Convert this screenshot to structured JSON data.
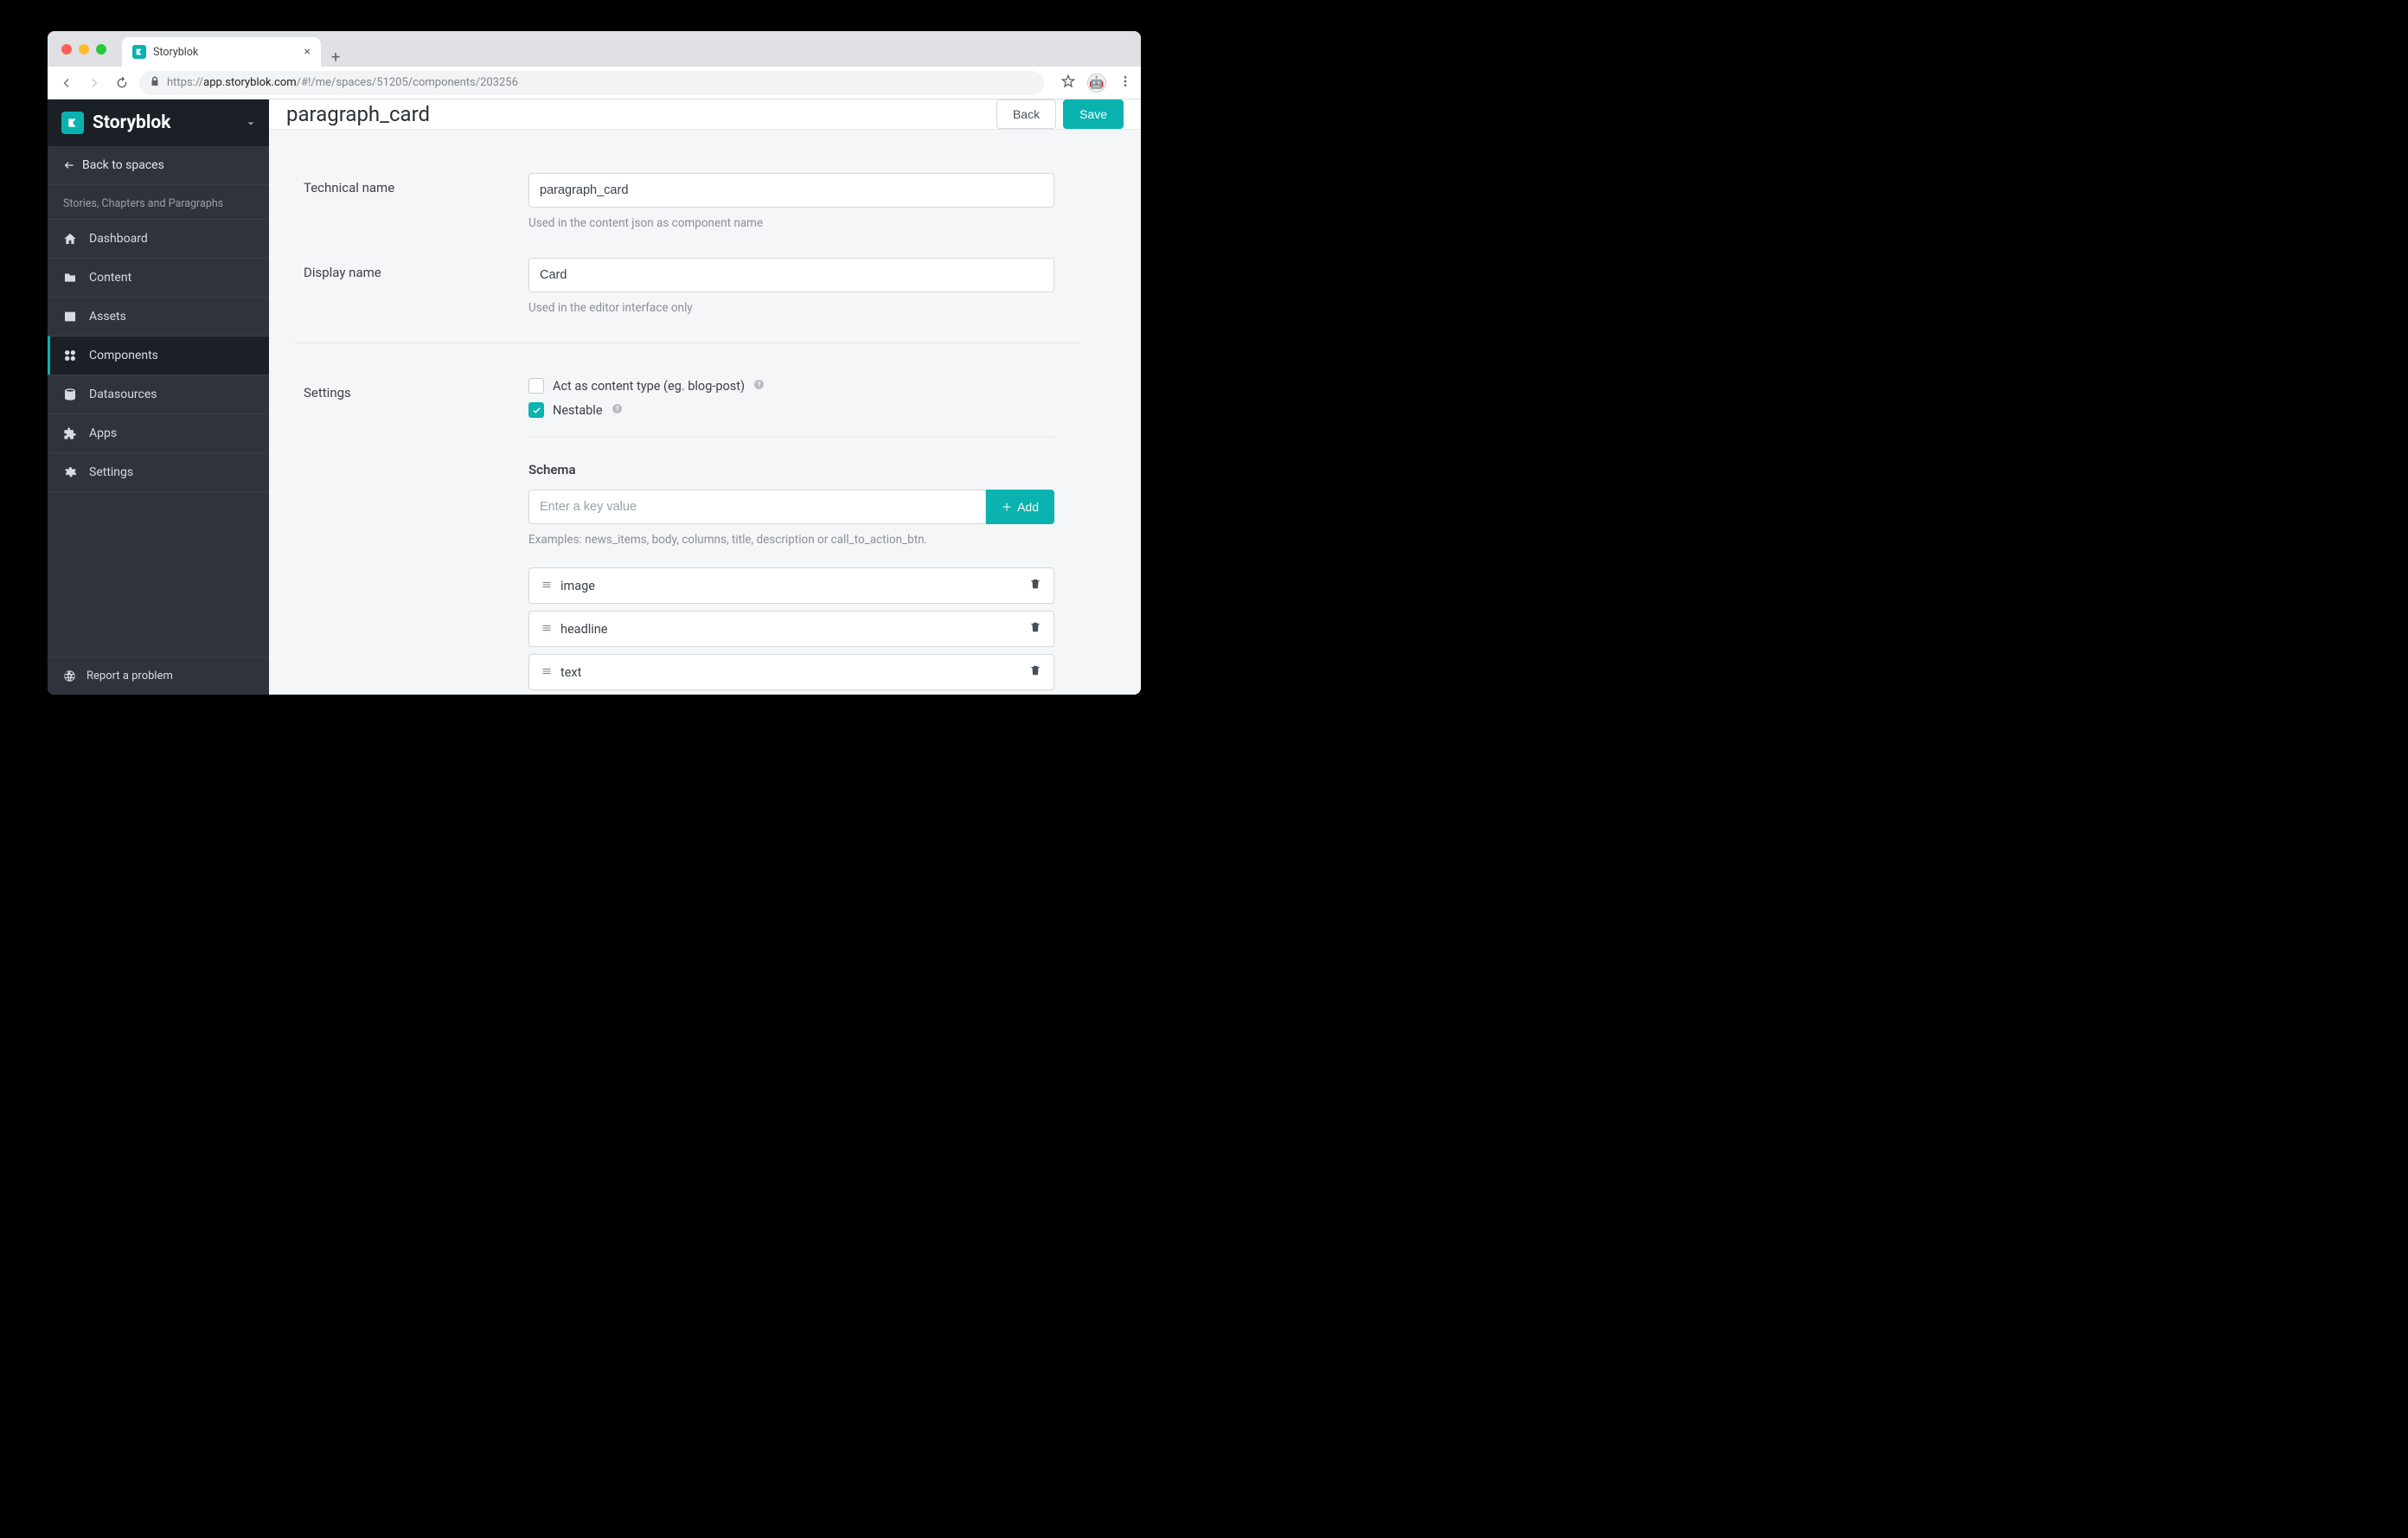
{
  "browser": {
    "tab_title": "Storyblok",
    "url_prefix": "https://",
    "url_host": "app.storyblok.com",
    "url_path": "/#!/me/spaces/51205/components/203256"
  },
  "sidebar": {
    "brand": "Storyblok",
    "back_label": "Back to spaces",
    "workspace": "Stories, Chapters and Paragraphs",
    "items": [
      {
        "label": "Dashboard"
      },
      {
        "label": "Content"
      },
      {
        "label": "Assets"
      },
      {
        "label": "Components"
      },
      {
        "label": "Datasources"
      },
      {
        "label": "Apps"
      },
      {
        "label": "Settings"
      }
    ],
    "footer": "Report a problem"
  },
  "topbar": {
    "title": "paragraph_card",
    "back": "Back",
    "save": "Save"
  },
  "form": {
    "tech_label": "Technical name",
    "tech_value": "paragraph_card",
    "tech_help": "Used in the content json as component name",
    "display_label": "Display name",
    "display_value": "Card",
    "display_help": "Used in the editor interface only",
    "settings_label": "Settings",
    "cb_content_type": "Act as content type (eg. blog-post)",
    "cb_nestable": "Nestable",
    "schema_label": "Schema",
    "schema_placeholder": "Enter a key value",
    "add_label": "Add",
    "schema_help": "Examples: news_items, body, columns, title, description or call_to_action_btn.",
    "schema_items": [
      {
        "name": "image"
      },
      {
        "name": "headline"
      },
      {
        "name": "text"
      }
    ]
  }
}
